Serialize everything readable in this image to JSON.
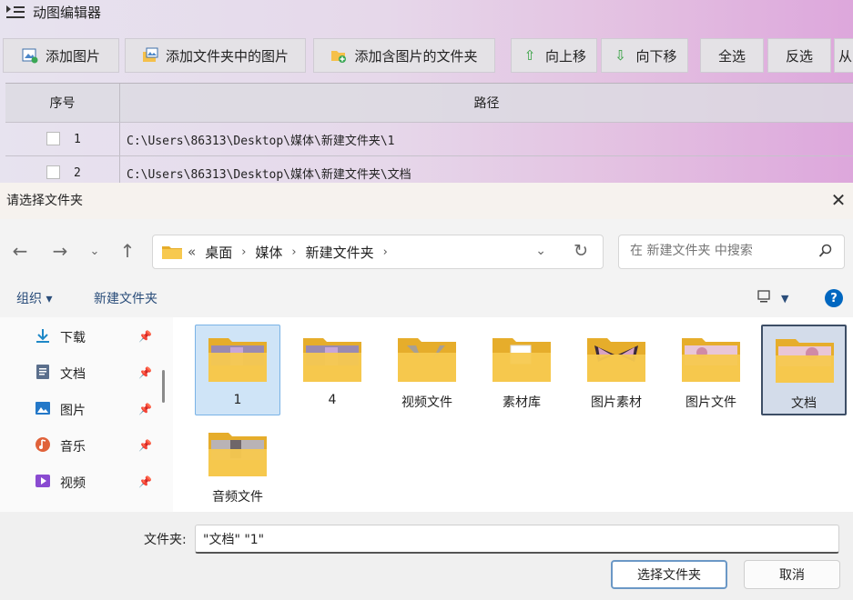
{
  "app": {
    "title": "动图编辑器",
    "toolbar": [
      {
        "label": "添加图片",
        "icon": "add-image-icon"
      },
      {
        "label": "添加文件夹中的图片",
        "icon": "folder-images-icon"
      },
      {
        "label": "添加含图片的文件夹",
        "icon": "add-folder-icon"
      },
      {
        "label": "向上移",
        "icon": "arrow-up-icon"
      },
      {
        "label": "向下移",
        "icon": "arrow-down-icon"
      },
      {
        "label": "全选"
      },
      {
        "label": "反选"
      },
      {
        "label": "从"
      }
    ],
    "table": {
      "headers": [
        "序号",
        "路径"
      ],
      "rows": [
        {
          "num": "1",
          "path": "C:\\Users\\86313\\Desktop\\媒体\\新建文件夹\\1"
        },
        {
          "num": "2",
          "path": "C:\\Users\\86313\\Desktop\\媒体\\新建文件夹\\文档"
        }
      ]
    }
  },
  "dialog": {
    "title": "请选择文件夹",
    "close": "✕",
    "breadcrumb": {
      "overflow": "«",
      "items": [
        "桌面",
        "媒体",
        "新建文件夹"
      ]
    },
    "search_placeholder": "在 新建文件夹 中搜索",
    "commands": {
      "organize": "组织 ▾",
      "new_folder": "新建文件夹",
      "help": "?"
    },
    "sidebar": [
      {
        "label": "下载",
        "icon": "download-icon",
        "color": "#1e88c7"
      },
      {
        "label": "文档",
        "icon": "document-icon",
        "color": "#5b6f8c"
      },
      {
        "label": "图片",
        "icon": "picture-icon",
        "color": "#2478c8"
      },
      {
        "label": "音乐",
        "icon": "music-icon",
        "color": "#e0623a"
      },
      {
        "label": "视频",
        "icon": "video-icon",
        "color": "#8a4bd1"
      }
    ],
    "folders": [
      {
        "label": "1",
        "state": "selected"
      },
      {
        "label": "4",
        "state": "normal"
      },
      {
        "label": "视频文件",
        "state": "normal"
      },
      {
        "label": "素材库",
        "state": "normal"
      },
      {
        "label": "图片素材",
        "state": "normal"
      },
      {
        "label": "图片文件",
        "state": "normal"
      },
      {
        "label": "文档",
        "state": "focused"
      },
      {
        "label": "音频文件",
        "state": "normal"
      }
    ],
    "filename_label": "文件夹:",
    "filename_value": "\"文档\" \"1\"",
    "buttons": {
      "ok": "选择文件夹",
      "cancel": "取消"
    },
    "colors": {
      "folder": "#f7c94f",
      "folder_dark": "#e6ad2b",
      "accent": "#0067c0",
      "selection": "#cfe4f7"
    }
  }
}
